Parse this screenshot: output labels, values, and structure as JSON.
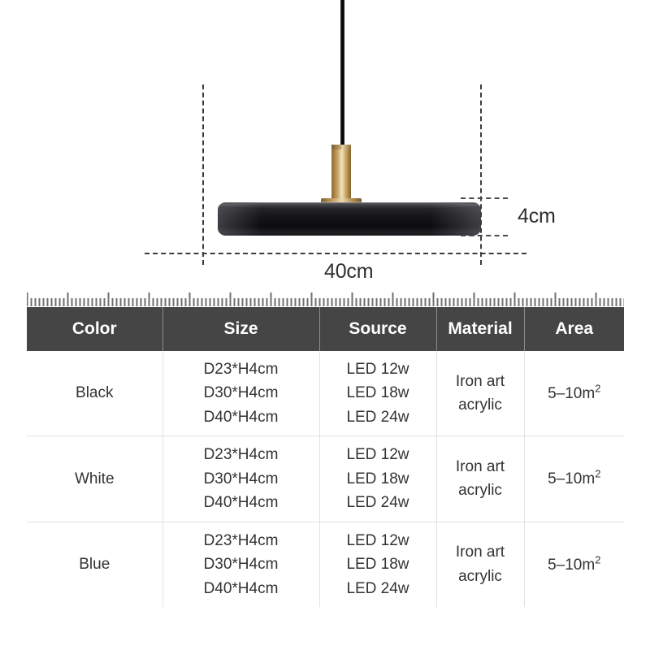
{
  "diagram": {
    "product": "pendant-lamp-disc",
    "width_label": "40cm",
    "height_label": "4cm",
    "shade_color": "#17171a",
    "stem_color": "#cbab70",
    "cord_color": "#000000",
    "guide_color": "#3c3c3c"
  },
  "ruler": {
    "tick_color": "#6f6f6f",
    "minor_ticks": 147,
    "major_every": 10
  },
  "table": {
    "header_bg": "#454545",
    "header_text_color": "#ffffff",
    "columns": [
      {
        "key": "color",
        "label": "Color"
      },
      {
        "key": "size",
        "label": "Size"
      },
      {
        "key": "source",
        "label": "Source"
      },
      {
        "key": "material",
        "label": "Material"
      },
      {
        "key": "area",
        "label": "Area"
      }
    ],
    "rows": [
      {
        "color": "Black",
        "size": [
          "D23*H4cm",
          "D30*H4cm",
          "D40*H4cm"
        ],
        "source": [
          "LED 12w",
          "LED 18w",
          "LED 24w"
        ],
        "material": [
          "Iron art",
          "acrylic"
        ],
        "area_value": "5–10m",
        "area_sup": "2"
      },
      {
        "color": "White",
        "size": [
          "D23*H4cm",
          "D30*H4cm",
          "D40*H4cm"
        ],
        "source": [
          "LED 12w",
          "LED 18w",
          "LED 24w"
        ],
        "material": [
          "Iron art",
          "acrylic"
        ],
        "area_value": "5–10m",
        "area_sup": "2"
      },
      {
        "color": "Blue",
        "size": [
          "D23*H4cm",
          "D30*H4cm",
          "D40*H4cm"
        ],
        "source": [
          "LED 12w",
          "LED 18w",
          "LED 24w"
        ],
        "material": [
          "Iron art",
          "acrylic"
        ],
        "area_value": "5–10m",
        "area_sup": "2"
      }
    ]
  }
}
